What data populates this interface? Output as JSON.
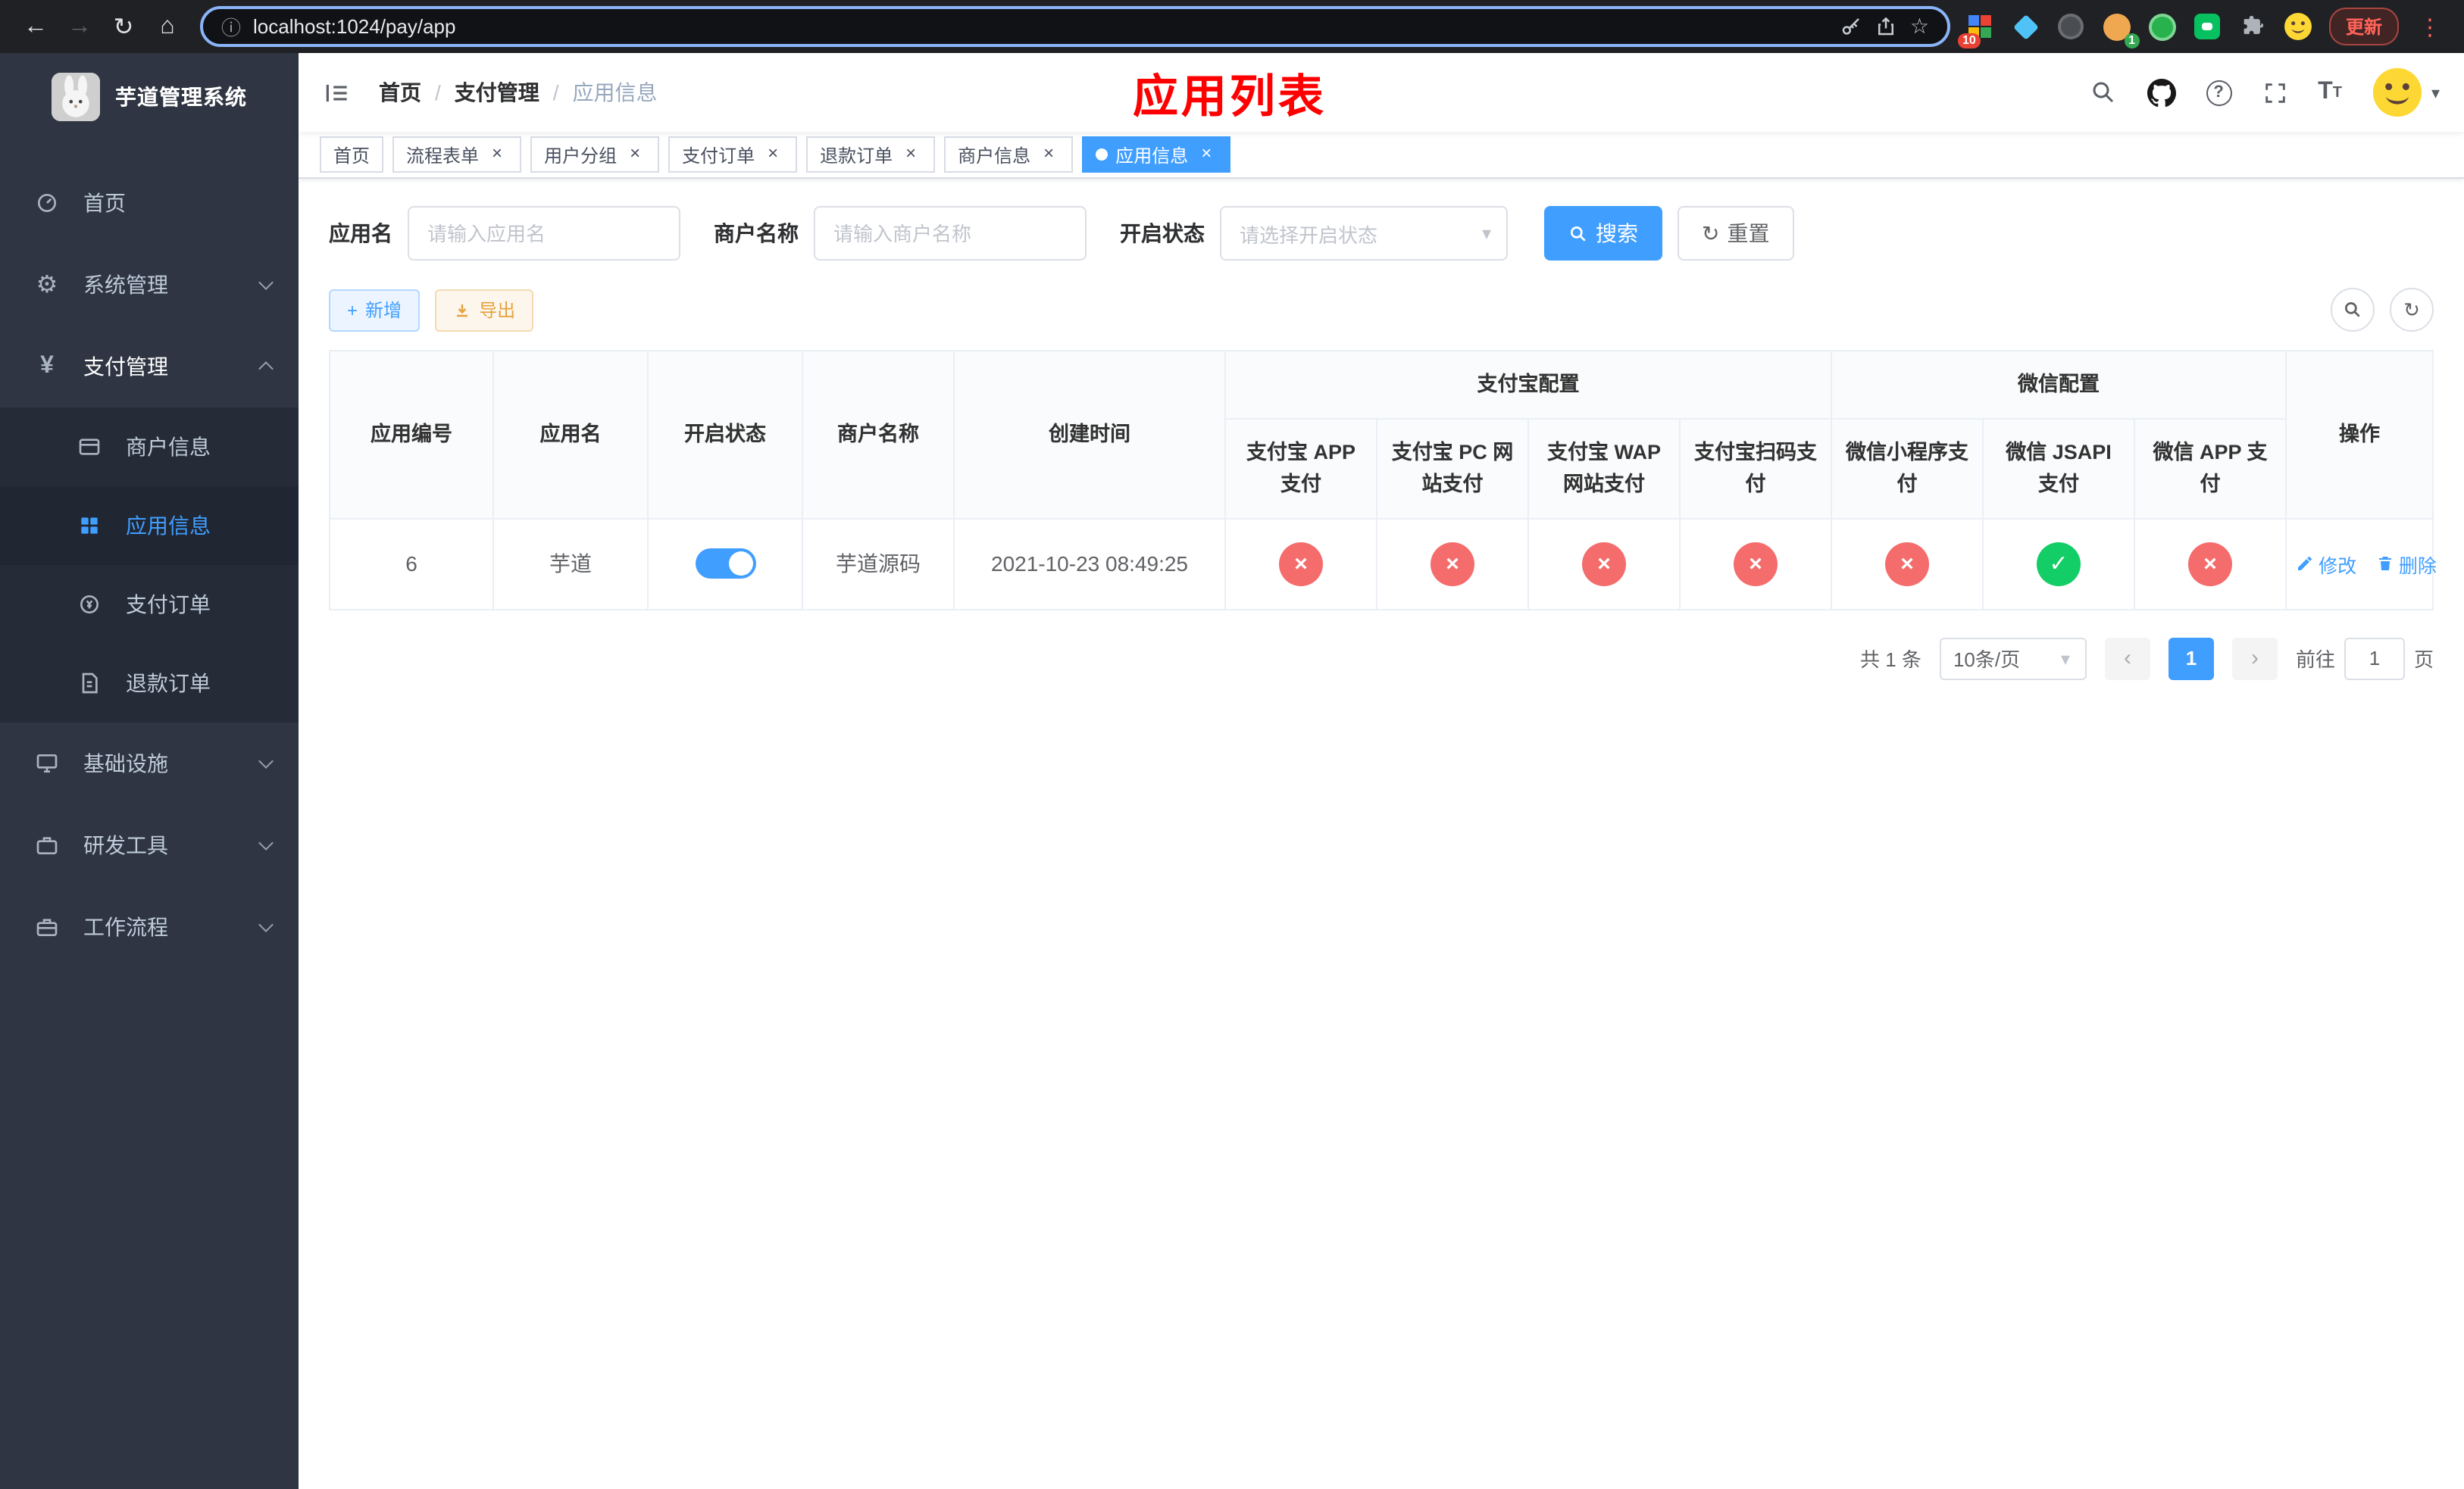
{
  "icons": {
    "back": "←",
    "forward": "→",
    "reload": "↻",
    "home": "⌂",
    "info": "ⓘ",
    "star": "☆",
    "menu_dots": "⋮",
    "gear": "⚙",
    "yen": "¥",
    "check": "✓",
    "cross": "×",
    "caret_down": "▾",
    "prev": "‹",
    "next": "›",
    "plus": "+",
    "question": "?"
  },
  "browser": {
    "url": "localhost:1024/pay/app",
    "update_label": "更新",
    "grid_ext_badge": "10",
    "avatar_ext_badge": "1"
  },
  "sidebar": {
    "logo_title": "芋道管理系统",
    "items": [
      {
        "label": "首页"
      },
      {
        "label": "系统管理"
      },
      {
        "label": "支付管理",
        "children": [
          {
            "label": "商户信息"
          },
          {
            "label": "应用信息"
          },
          {
            "label": "支付订单"
          },
          {
            "label": "退款订单"
          }
        ]
      },
      {
        "label": "基础设施"
      },
      {
        "label": "研发工具"
      },
      {
        "label": "工作流程"
      }
    ]
  },
  "header": {
    "separator": "/",
    "breadcrumb": [
      {
        "label": "首页"
      },
      {
        "label": "支付管理"
      },
      {
        "label": "应用信息"
      }
    ],
    "page_heading": "应用列表"
  },
  "tabs": [
    {
      "label": "首页"
    },
    {
      "label": "流程表单"
    },
    {
      "label": "用户分组"
    },
    {
      "label": "支付订单"
    },
    {
      "label": "退款订单"
    },
    {
      "label": "商户信息"
    },
    {
      "label": "应用信息"
    }
  ],
  "filters": {
    "app_name_label": "应用名",
    "app_name_placeholder": "请输入应用名",
    "merchant_label": "商户名称",
    "merchant_placeholder": "请输入商户名称",
    "status_label": "开启状态",
    "status_placeholder": "请选择开启状态",
    "search_label": "搜索",
    "reset_label": "重置"
  },
  "toolbar": {
    "add_label": "新增",
    "export_label": "导出"
  },
  "table": {
    "group_headers": {
      "alipay": "支付宝配置",
      "wechat": "微信配置"
    },
    "headers": {
      "app_id": "应用编号",
      "app_name": "应用名",
      "status": "开启状态",
      "merchant_name": "商户名称",
      "create_time": "创建时间",
      "alipay_app": "支付宝 APP 支付",
      "alipay_pc": "支付宝 PC 网站支付",
      "alipay_wap": "支付宝 WAP 网站支付",
      "alipay_qr": "支付宝扫码支付",
      "wechat_mini": "微信小程序支付",
      "wechat_jsapi": "微信 JSAPI 支付",
      "wechat_app": "微信 APP 支付",
      "actions": "操作"
    },
    "rows": [
      {
        "app_id": "6",
        "app_name": "芋道",
        "status_on": true,
        "merchant_name": "芋道源码",
        "create_time": "2021-10-23 08:49:25",
        "alipay_app": false,
        "alipay_pc": false,
        "alipay_wap": false,
        "alipay_qr": false,
        "wechat_mini": false,
        "wechat_jsapi": true,
        "wechat_app": false,
        "edit_label": "修改",
        "delete_label": "删除"
      }
    ]
  },
  "pagination": {
    "total": "共 1 条",
    "page_size": "10条/页",
    "current_page": "1",
    "goto_prefix": "前往",
    "goto_value": "1",
    "goto_suffix": "页"
  },
  "colors": {
    "primary": "#409eff",
    "success": "#13ce66",
    "danger": "#f56c6c",
    "warning": "#e6a23c",
    "heading_red": "#ff0000"
  }
}
